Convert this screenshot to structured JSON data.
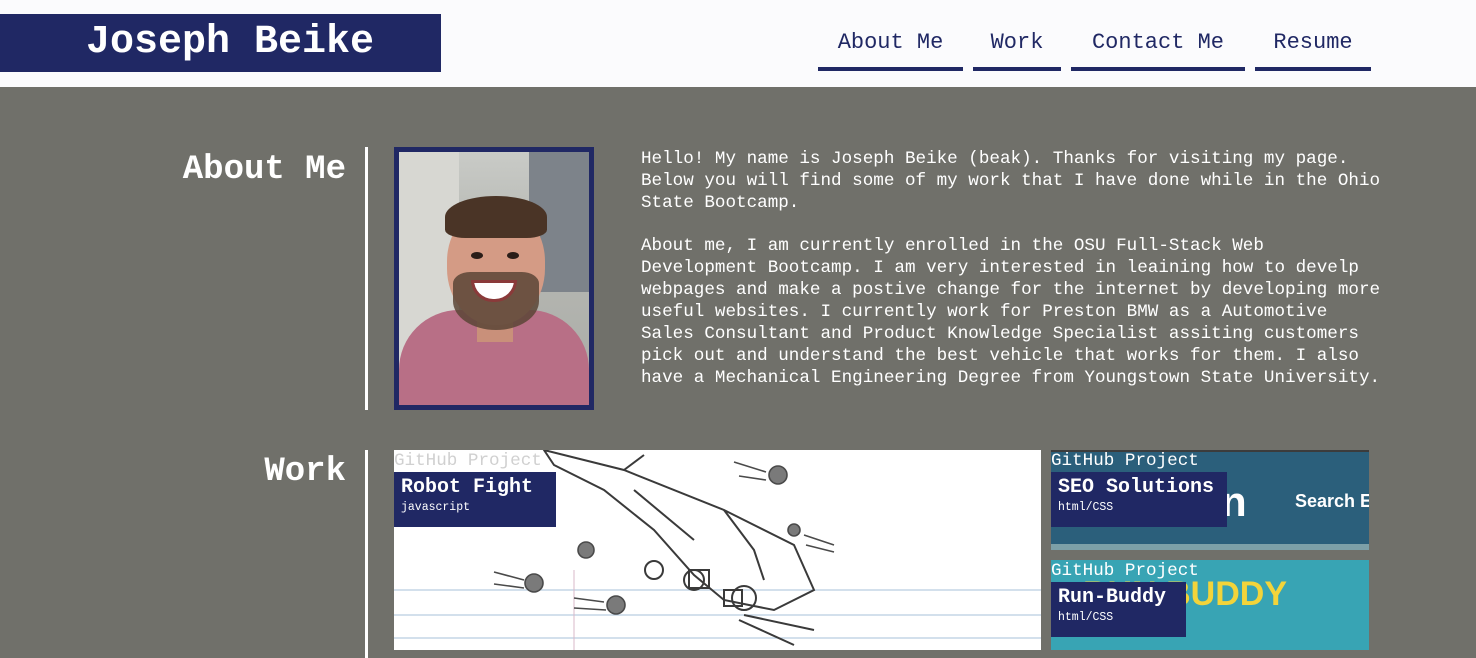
{
  "header": {
    "brand": "Joseph Beike",
    "nav": [
      {
        "label": "About Me"
      },
      {
        "label": "Work"
      },
      {
        "label": "Contact Me"
      },
      {
        "label": "Resume"
      }
    ]
  },
  "about": {
    "title": "About Me",
    "photo_alt": "Photo of Joseph Beike",
    "paragraphs": [
      "Hello! My name is Joseph Beike (beak). Thanks for visiting my page. Below you will find some of my work that I have done while in the Ohio State Bootcamp.",
      "About me, I am currently enrolled in the OSU Full-Stack Web Development Bootcamp. I am very interested in leaining how to develp webpages and make a postive change for the internet by developing more useful websites. I currently work for Preston BMW as a Automotive Sales Consultant and Product Knowledge Specialist assiting customers pick out and understand the best vehicle that works for them. I also have a Mechanical Engineering Degree from Youngstown State University."
    ]
  },
  "work": {
    "title": "Work",
    "projects": [
      {
        "kicker": "GitHub Project",
        "title": "Robot Fight",
        "tech": "javascript"
      },
      {
        "kicker": "GitHub Project",
        "title": "SEO Solutions",
        "tech": "html/CSS",
        "bg_text_1": "n",
        "bg_text_2": "Search Er"
      },
      {
        "kicker": "GitHub Project",
        "title": "Run-Buddy",
        "tech": "html/CSS",
        "bg_text": "RUN BUDDY"
      }
    ]
  },
  "colors": {
    "brand": "#202864",
    "page_bg": "#70706a",
    "header_bg": "#fbfbfd",
    "seo_bg": "#2b5f7b",
    "runbuddy_bg": "#38a4b4",
    "runbuddy_text": "#f2d43a"
  }
}
